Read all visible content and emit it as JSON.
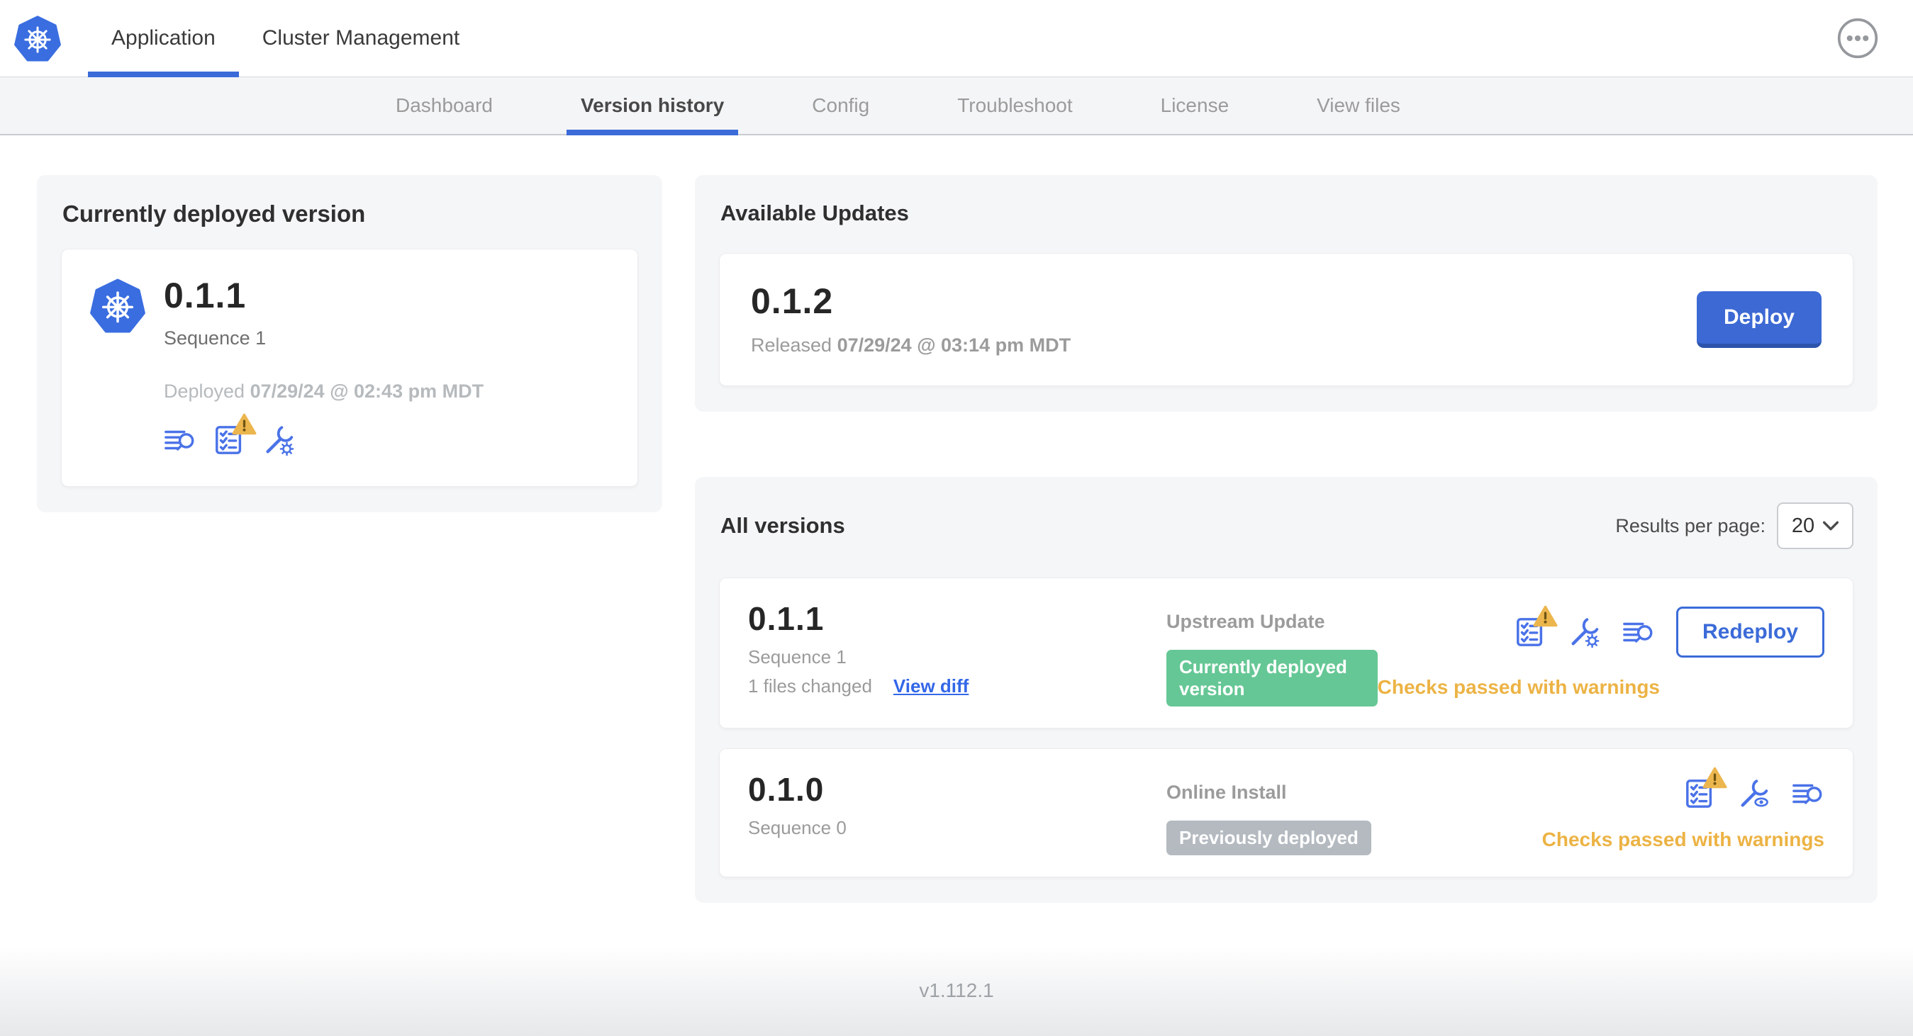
{
  "header": {
    "tabs": [
      {
        "label": "Application",
        "active": true
      },
      {
        "label": "Cluster Management",
        "active": false
      }
    ]
  },
  "subnav": {
    "items": [
      {
        "label": "Dashboard",
        "active": false
      },
      {
        "label": "Version history",
        "active": true
      },
      {
        "label": "Config",
        "active": false
      },
      {
        "label": "Troubleshoot",
        "active": false
      },
      {
        "label": "License",
        "active": false
      },
      {
        "label": "View files",
        "active": false
      }
    ]
  },
  "currently_deployed": {
    "title": "Currently deployed version",
    "version": "0.1.1",
    "sequence": "Sequence 1",
    "deployed_prefix": "Deployed",
    "deployed_date": "07/29/24 @ 02:43 pm MDT",
    "icons": [
      "log-lines-magnifier-icon",
      "checklist-warning-icon",
      "wrench-gear-icon"
    ]
  },
  "available_updates": {
    "title": "Available Updates",
    "version": "0.1.2",
    "released_prefix": "Released",
    "released_date": "07/29/24 @ 03:14 pm MDT",
    "deploy_label": "Deploy"
  },
  "all_versions": {
    "title": "All versions",
    "results_per_page_label": "Results per page:",
    "results_per_page_value": "20",
    "rows": [
      {
        "version": "0.1.1",
        "sequence": "Sequence 1",
        "files_changed": "1 files changed",
        "view_diff_label": "View diff",
        "source": "Upstream Update",
        "badge": "Currently deployed version",
        "badge_color": "green",
        "action_label": "Redeploy",
        "checks_status": "Checks passed with warnings",
        "icons": [
          "checklist-warning-icon",
          "wrench-gear-icon",
          "log-lines-magnifier-icon"
        ]
      },
      {
        "version": "0.1.0",
        "sequence": "Sequence 0",
        "source": "Online Install",
        "badge": "Previously deployed",
        "badge_color": "gray",
        "checks_status": "Checks passed with warnings",
        "icons": [
          "checklist-warning-icon",
          "wrench-eye-icon",
          "log-lines-magnifier-icon"
        ]
      }
    ]
  },
  "footer": {
    "app_version": "v1.112.1"
  },
  "icons": {
    "logo": "kubernetes-logo",
    "more_options": "ellipsis-circle-icon",
    "select_chevron": "chevron-down-icon",
    "warning_overlay": "warning-triangle-icon"
  },
  "colors": {
    "primary_blue": "#3b6bd8",
    "button_blue": "#3c69d4",
    "icon_blue": "#4a72e8",
    "kubernetes_blue": "#3a6de0",
    "link_blue": "#3367e8",
    "success_green": "#65c795",
    "neutral_badge_gray": "#b4bac0",
    "warning_amber": "#ecb344",
    "warning_triangle": "#ecb64e"
  }
}
